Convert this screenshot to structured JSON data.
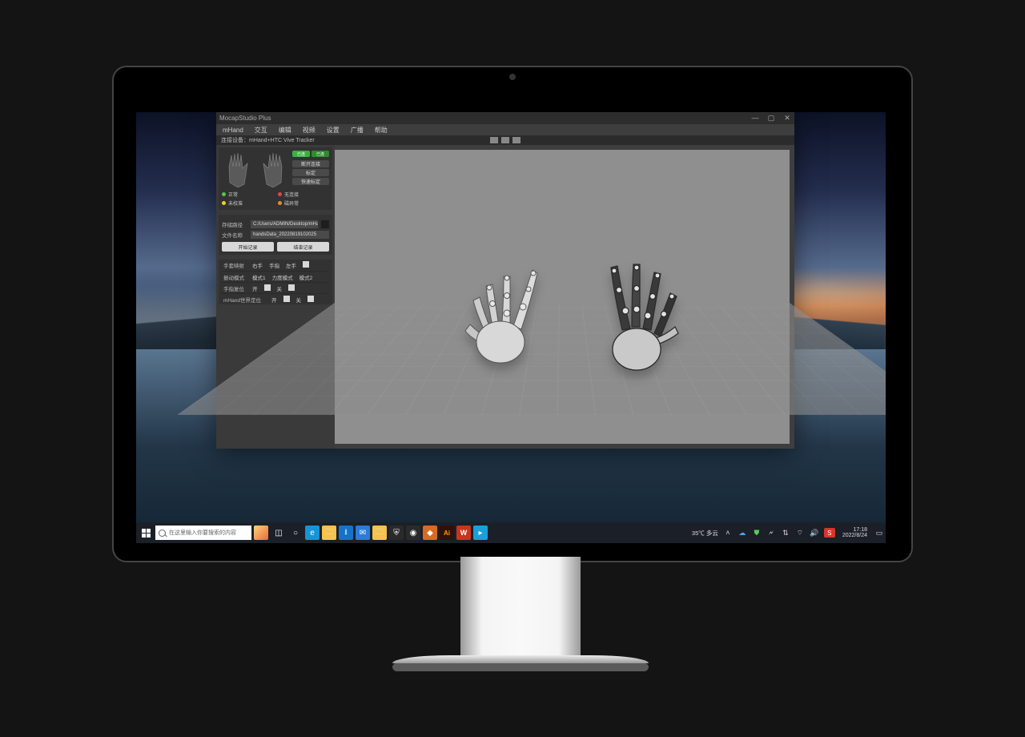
{
  "app": {
    "title": "MocapStudio Plus",
    "menu": [
      "mHand",
      "交互",
      "编辑",
      "视频",
      "设置",
      "广播",
      "帮助"
    ],
    "device_label": "连接设备：",
    "device_value": "mHand+HTC Vive Tracker",
    "badges": [
      "已连",
      "已连"
    ],
    "conn_buttons": [
      "断开连接",
      "标定",
      "快速标定"
    ],
    "status": [
      {
        "color": "d-green",
        "label": "正常"
      },
      {
        "color": "d-red",
        "label": "无连接"
      },
      {
        "color": "d-yellow",
        "label": "未校准"
      },
      {
        "color": "d-orange",
        "label": "磁异常"
      }
    ],
    "save": {
      "path_label": "存储路径",
      "path_value": "C:/Users/ADMIN/Desktop/mHand",
      "file_label": "文件名称",
      "file_value": "handsData_20220819102025",
      "start": "开始记录",
      "stop": "结束记录"
    },
    "opts": {
      "handmap_label": "手套映射",
      "right": "右手",
      "pos": "手指",
      "left": "左手",
      "vibe_label": "振动模式",
      "m1": "模式1",
      "strength": "力度模式",
      "m2": "模式2",
      "restore_label": "手指复位",
      "open": "开",
      "close": "关",
      "world_label": "mHand世界定位"
    }
  },
  "taskbar": {
    "search_placeholder": "在这里输入你要搜索的内容",
    "weather": "35℃ 多云",
    "time": "17:18",
    "date": "2022/8/24"
  }
}
